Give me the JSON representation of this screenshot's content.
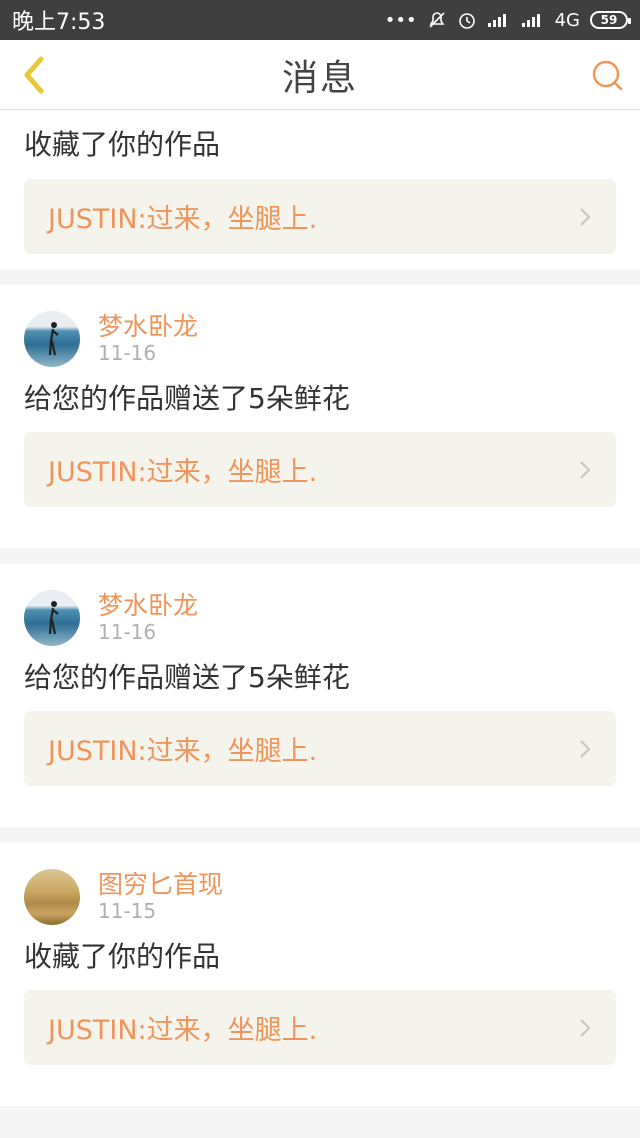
{
  "status_bar": {
    "time": "晚上7:53",
    "network": "4G",
    "battery": "59",
    "dots": "•••"
  },
  "nav": {
    "title": "消息",
    "accent_color": "#f0955a",
    "back_color": "#e8c838"
  },
  "feed": {
    "partial_item": {
      "action": "收藏了你的作品",
      "quote": "JUSTIN:过来，坐腿上."
    },
    "items": [
      {
        "user": "梦水卧龙",
        "date": "11-16",
        "action": "给您的作品赠送了5朵鲜花",
        "quote": "JUSTIN:过来，坐腿上.",
        "avatar": "lake-avatar"
      },
      {
        "user": "梦水卧龙",
        "date": "11-16",
        "action": "给您的作品赠送了5朵鲜花",
        "quote": "JUSTIN:过来，坐腿上.",
        "avatar": "lake-avatar"
      },
      {
        "user": "图穷匕首现",
        "date": "11-15",
        "action": "收藏了你的作品",
        "quote": "JUSTIN:过来，坐腿上.",
        "avatar": "field-avatar"
      }
    ]
  }
}
